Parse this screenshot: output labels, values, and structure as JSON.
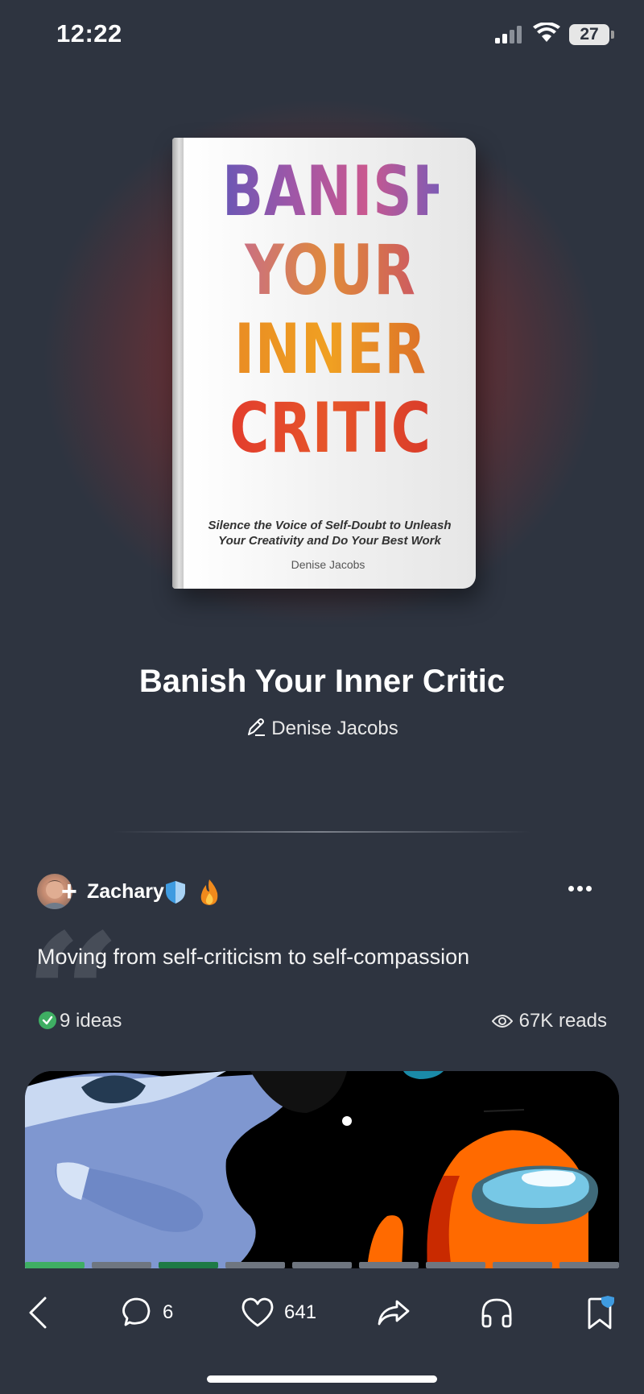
{
  "status_bar": {
    "time": "12:22",
    "battery": "27"
  },
  "book": {
    "cover": {
      "title_lines": [
        "BANISH",
        "YOUR",
        "INNER",
        "CRITIC"
      ],
      "subtitle": "Silence the Voice of Self-Doubt to Unleash Your Creativity and Do Your Best Work",
      "author": "Denise Jacobs"
    },
    "title": "Banish Your Inner Critic",
    "author": "Denise Jacobs"
  },
  "post": {
    "username": "Zachary",
    "quote": "Moving from self-criticism to self-compassion",
    "ideas": "9 ideas",
    "reads": "67K reads"
  },
  "progress": {
    "total_segments": 9,
    "current_segment": 3,
    "completed_segments": 1
  },
  "bottom_bar": {
    "comments": "6",
    "likes": "641"
  },
  "colors": {
    "background": "#2e3440",
    "glow": "#c8322a",
    "progress_done": "#3fae63",
    "progress_current": "#1e7a45",
    "progress_pending": "#6f7680"
  },
  "icons": [
    "signal-icon",
    "wifi-icon",
    "pen-icon",
    "shield-badge-icon",
    "fire-icon",
    "more-icon",
    "check-icon",
    "eye-icon",
    "back-icon",
    "comment-icon",
    "heart-icon",
    "share-icon",
    "headphones-icon",
    "bookmark-icon"
  ]
}
